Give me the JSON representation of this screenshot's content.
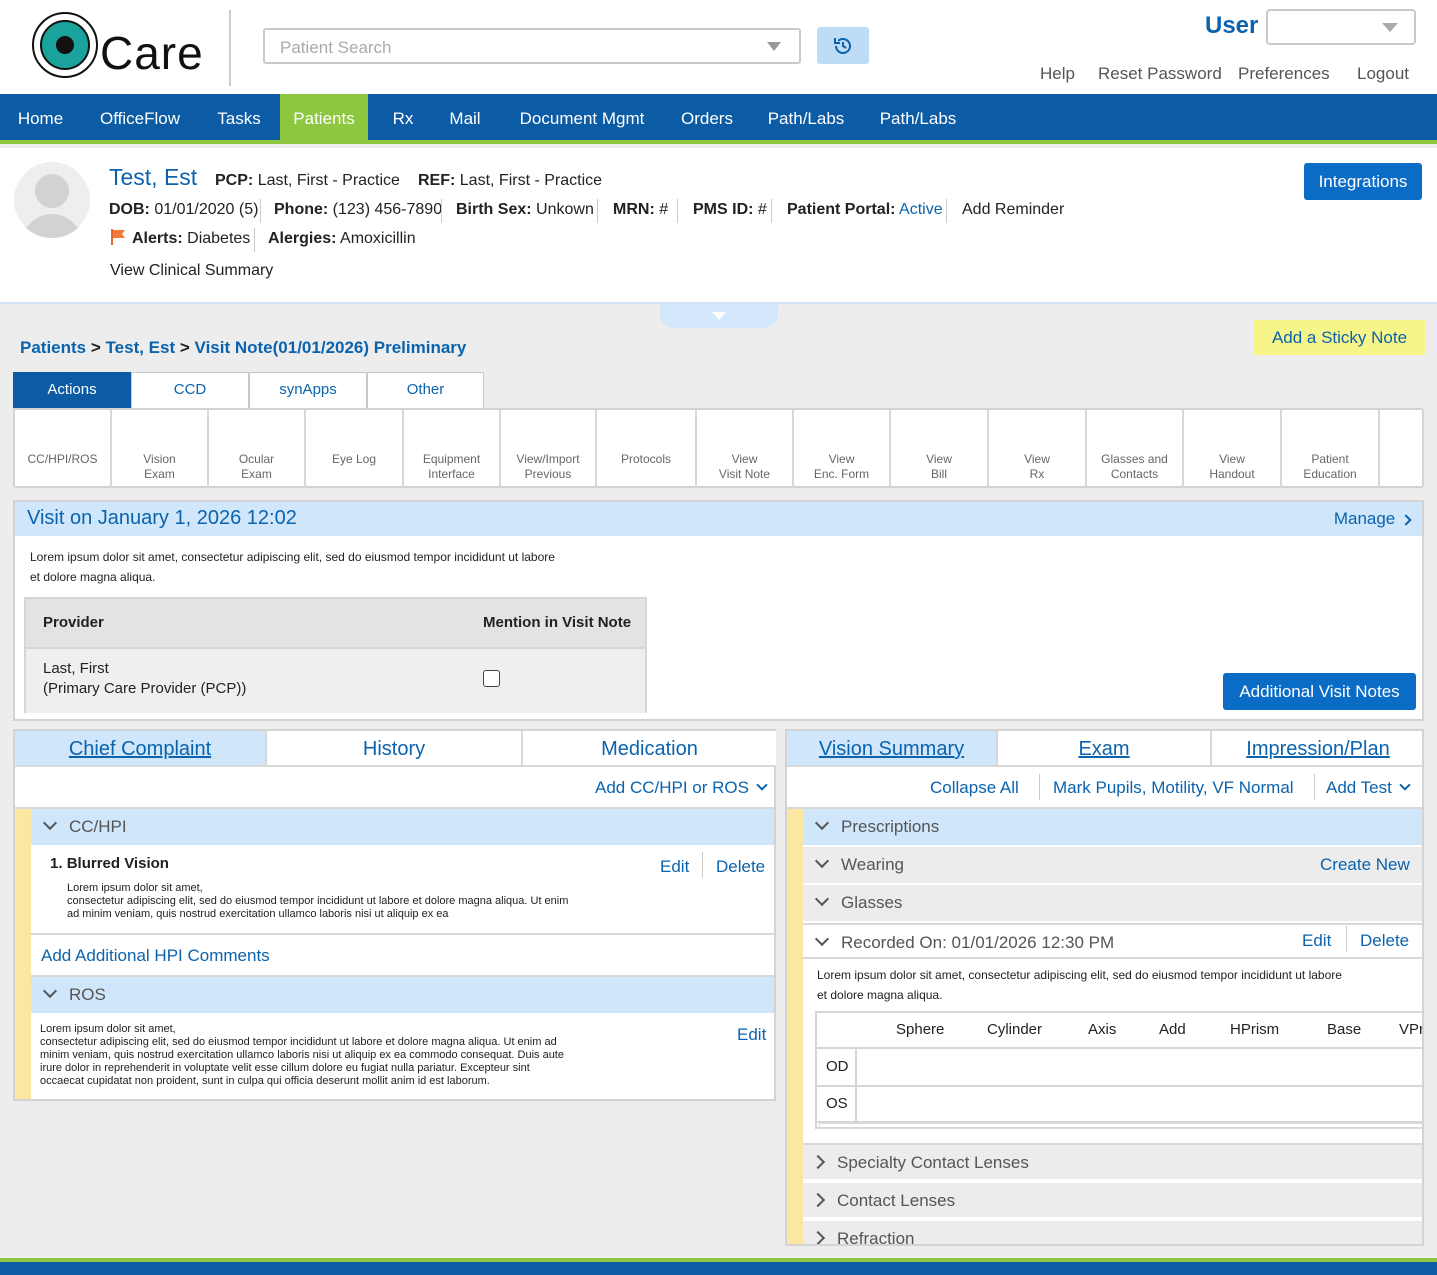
{
  "header": {
    "logo_text": "Care",
    "search_placeholder": "Patient Search",
    "user_label": "User",
    "links": [
      "Help",
      "Reset Password",
      "Preferences",
      "Logout"
    ]
  },
  "nav": {
    "items": [
      "Home",
      "OfficeFlow",
      "Tasks",
      "Patients",
      "Rx",
      "Mail",
      "Document Mgmt",
      "Orders",
      "Path/Labs",
      "Path/Labs"
    ],
    "active": "Patients"
  },
  "patient": {
    "name": "Test, Est",
    "pcp_label": "PCP:",
    "pcp": "Last, First - Practice",
    "ref_label": "REF:",
    "ref": "Last, First - Practice",
    "dob_label": "DOB:",
    "dob": "01/01/2020 (5)",
    "phone_label": "Phone:",
    "phone": "(123) 456-7890",
    "sex_label": "Birth Sex:",
    "sex": "Unkown",
    "mrn_label": "MRN:",
    "mrn": "#",
    "pms_label": "PMS ID:",
    "pms": "#",
    "portal_label": "Patient Portal:",
    "portal": "Active",
    "add_reminder": "Add Reminder",
    "alerts_label": "Alerts:",
    "alerts": "Diabetes",
    "allergies_label": "Alergies:",
    "allergies": "Amoxicillin",
    "clinical_summary": "View Clinical Summary",
    "integrations": "Integrations"
  },
  "breadcrumb": {
    "patients": "Patients",
    "patient": "Test, Est",
    "note": "Visit Note(01/01/2026) Preliminary",
    "sep": ">"
  },
  "sticky": "Add a Sticky Note",
  "action_tabs": [
    "Actions",
    "CCD",
    "synApps",
    "Other"
  ],
  "actions": [
    [
      "CC/HPI/ROS",
      ""
    ],
    [
      "Vision",
      "Exam"
    ],
    [
      "Ocular",
      "Exam"
    ],
    [
      "Eye Log",
      ""
    ],
    [
      "Equipment",
      "Interface"
    ],
    [
      "View/Import",
      "Previous"
    ],
    [
      "Protocols",
      ""
    ],
    [
      "View",
      "Visit Note"
    ],
    [
      "View",
      "Enc. Form"
    ],
    [
      "View",
      "Bill"
    ],
    [
      "View",
      "Rx"
    ],
    [
      "Glasses and",
      "Contacts"
    ],
    [
      "View",
      "Handout"
    ],
    [
      "Patient",
      "Education"
    ]
  ],
  "visit": {
    "title": "Visit on January 1, 2026 12:02",
    "manage": "Manage",
    "text1": "Lorem ipsum dolor sit amet, consectetur adipiscing elit, sed do eiusmod tempor incididunt ut labore",
    "text2": "et dolore magna aliqua.",
    "col_provider": "Provider",
    "col_mention": "Mention in Visit Note",
    "provider_name": "Last, First",
    "provider_role": "(Primary Care Provider (PCP))",
    "additional": "Additional Visit Notes"
  },
  "left": {
    "tabs": [
      "Chief Complaint",
      "History",
      "Medication"
    ],
    "add_menu": "Add CC/HPI or ROS",
    "cc_head": "CC/HPI",
    "item_num": "1.",
    "item_title": "Blurred Vision",
    "edit": "Edit",
    "delete": "Delete",
    "item_lines": [
      "Lorem ipsum dolor sit amet,",
      "consectetur adipiscing elit, sed do eiusmod tempor incididunt ut labore et dolore magna aliqua. Ut enim",
      "ad minim veniam, quis nostrud exercitation ullamco laboris nisi ut aliquip ex ea"
    ],
    "add_hpi": "Add Additional HPI Comments",
    "ros_head": "ROS",
    "ros_edit": "Edit",
    "ros_lines": [
      "Lorem ipsum dolor sit amet,",
      "consectetur adipiscing elit, sed do eiusmod tempor incididunt ut labore et dolore magna aliqua. Ut enim ad",
      "minim veniam, quis nostrud exercitation ullamco laboris nisi ut aliquip ex ea commodo consequat. Duis aute",
      "irure dolor in reprehenderit in voluptate velit esse cillum dolore eu fugiat nulla pariatur. Excepteur sint",
      "occaecat cupidatat non proident, sunt in culpa qui officia deserunt mollit anim id est laborum."
    ]
  },
  "right": {
    "tabs": [
      "Vision Summary",
      "Exam",
      "Impression/Plan"
    ],
    "collapse_all": "Collapse All",
    "mark_normal": "Mark Pupils, Motility, VF Normal",
    "add_test": "Add Test",
    "prescriptions": "Prescriptions",
    "wearing": "Wearing",
    "create_new": "Create New",
    "glasses": "Glasses",
    "recorded": "Recorded On: 01/01/2026 12:30 PM",
    "edit": "Edit",
    "delete": "Delete",
    "text1": "Lorem ipsum dolor sit amet, consectetur adipiscing elit, sed do eiusmod tempor incididunt ut labore",
    "text2": "et dolore magna aliqua.",
    "rx_cols": [
      "Sphere",
      "Cylinder",
      "Axis",
      "Add",
      "HPrism",
      "Base",
      "VPrism"
    ],
    "rx_rows": [
      "OD",
      "OS"
    ],
    "specialty": "Specialty Contact Lenses",
    "contacts": "Contact Lenses",
    "refraction": "Refraction"
  }
}
